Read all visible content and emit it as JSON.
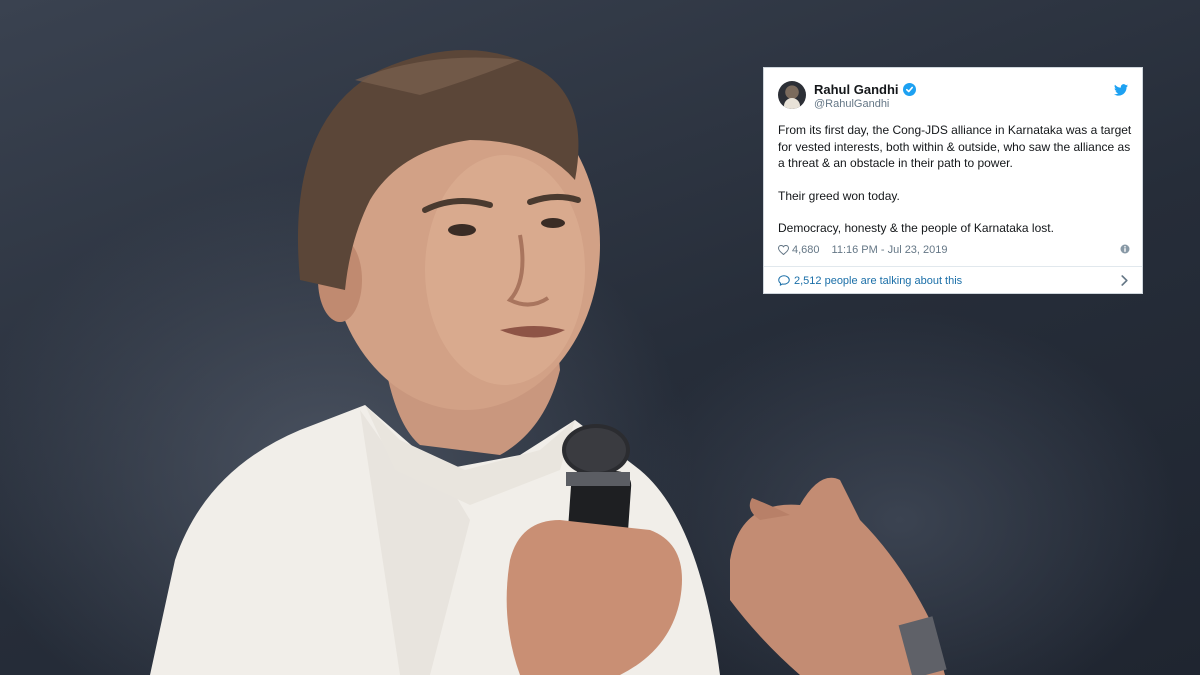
{
  "tweet": {
    "author_name": "Rahul Gandhi",
    "author_handle": "@RahulGandhi",
    "verified": true,
    "paragraphs": [
      "From its first day, the Cong-JDS alliance in Karnataka was a target for vested interests, both within & outside, who saw the alliance as a threat & an obstacle in their path to power.",
      "Their greed won today.",
      "Democracy, honesty & the people of Karnataka lost."
    ],
    "likes": "4,680",
    "timestamp": "11:16 PM - Jul 23, 2019",
    "talking": "2,512 people are talking about this"
  },
  "icons": {
    "avatar": "avatar-photo",
    "verified": "verified-badge-icon",
    "brand": "twitter-bird-icon",
    "like": "heart-icon",
    "info": "info-icon",
    "reply": "speech-bubble-icon",
    "more": "chevron-right-icon"
  },
  "colors": {
    "brand_blue": "#1da1f2",
    "link_blue": "#1b6fa8",
    "text": "#14171a",
    "muted": "#657786",
    "background_dark": "#2b3340",
    "shirt": "#f1eee9"
  }
}
